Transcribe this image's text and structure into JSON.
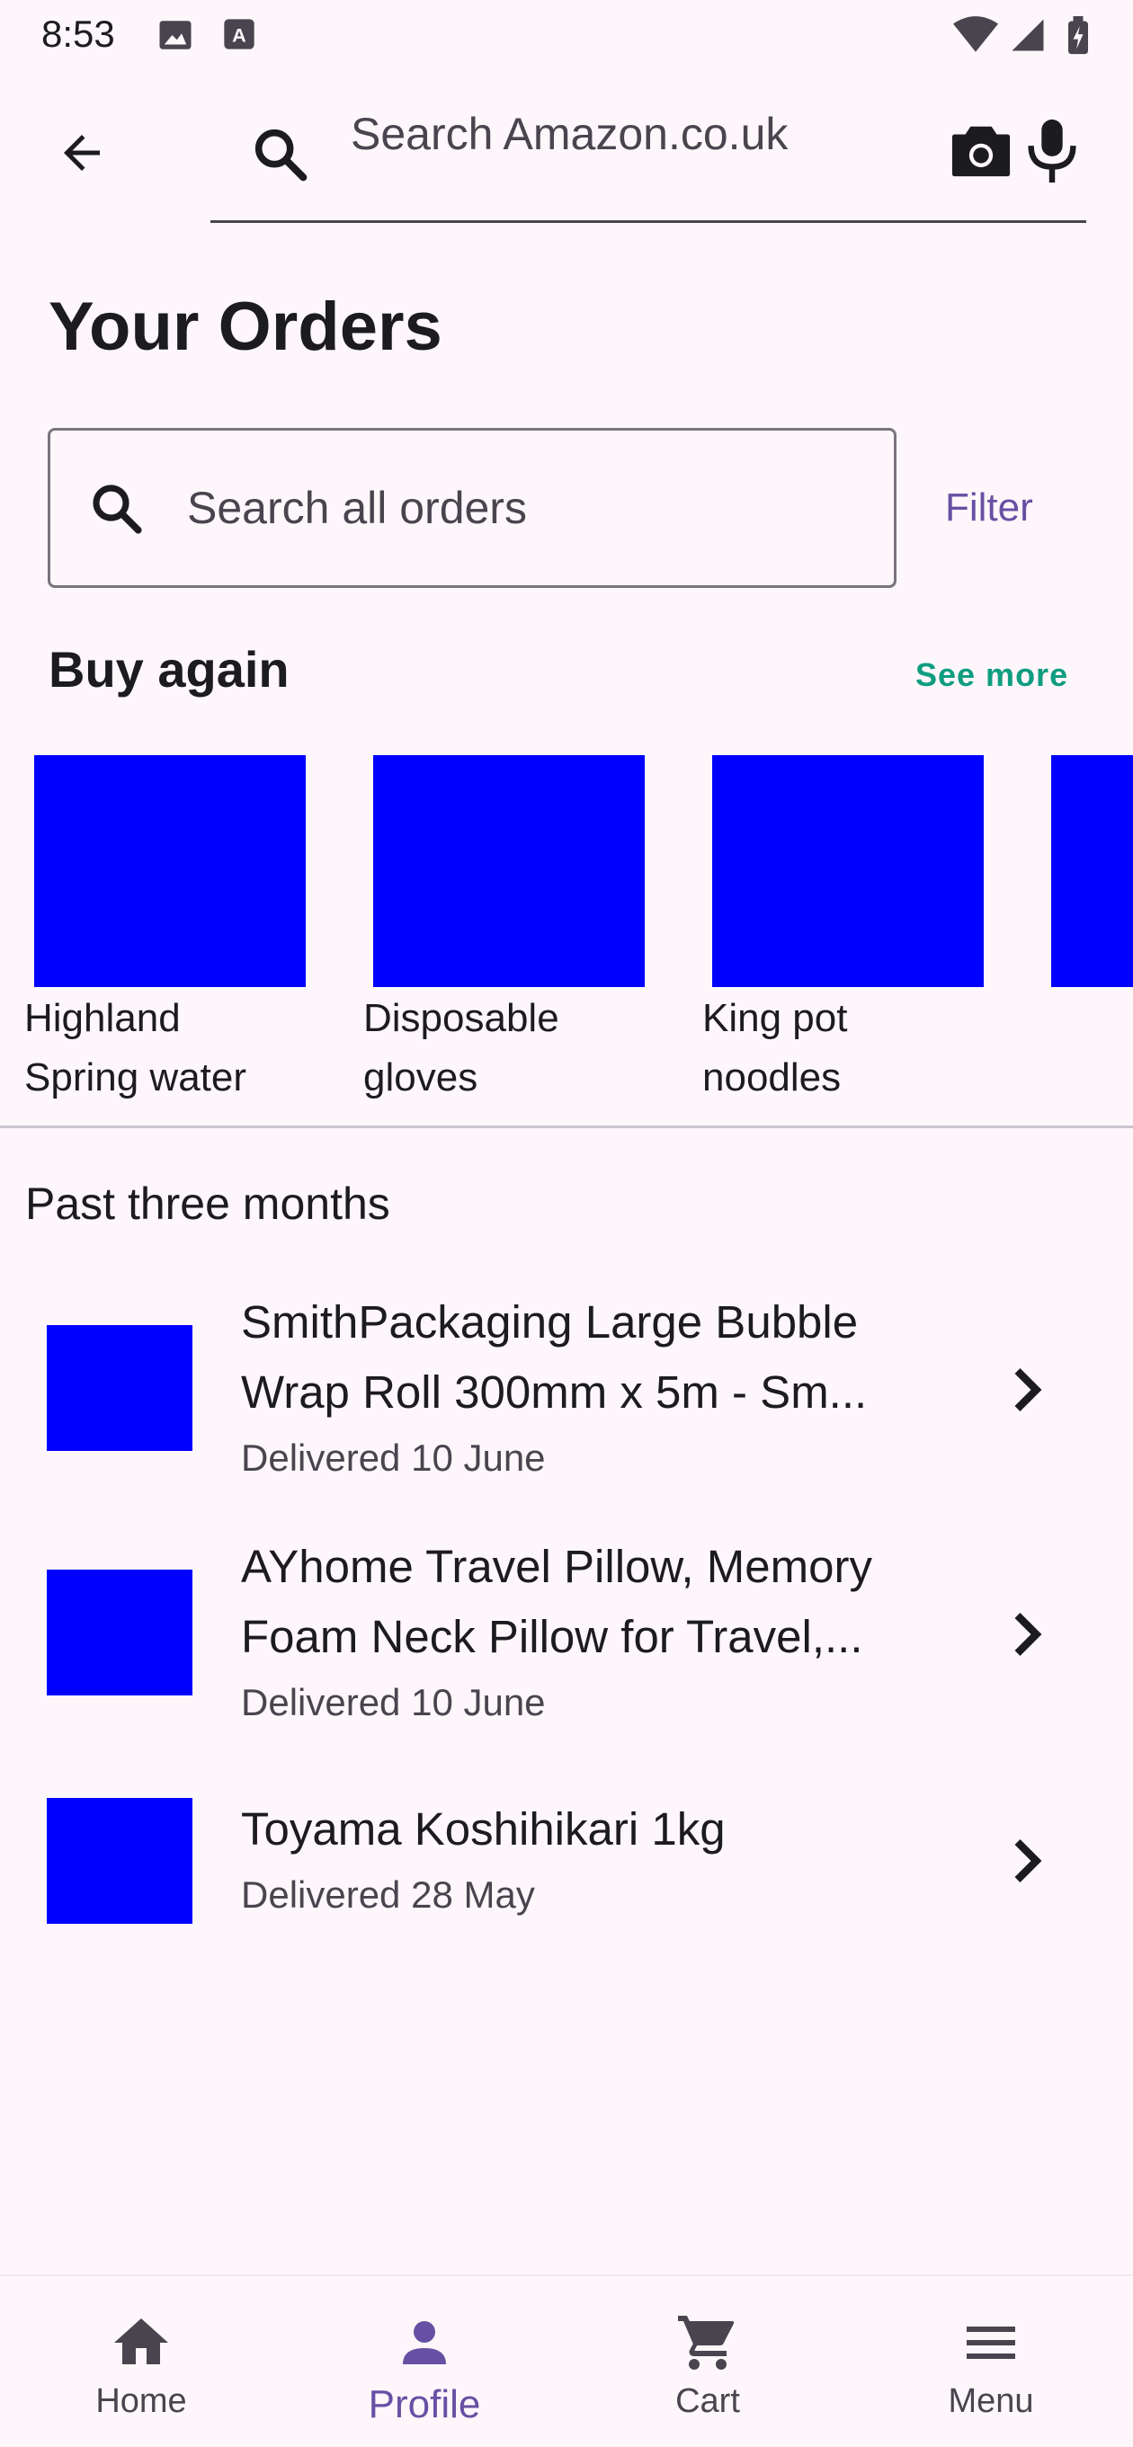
{
  "status_bar": {
    "time": "8:53"
  },
  "top_search": {
    "placeholder": "Search Amazon.co.uk"
  },
  "page": {
    "title": "Your Orders"
  },
  "orders_search": {
    "placeholder": "Search all orders",
    "filter_label": "Filter"
  },
  "buy_again": {
    "heading": "Buy again",
    "see_more": "See more",
    "items": [
      {
        "line1": "Highland",
        "line2": "Spring water"
      },
      {
        "line1": "Disposable",
        "line2": "gloves"
      },
      {
        "line1": "King pot",
        "line2": "noodles"
      }
    ]
  },
  "past": {
    "heading": "Past three months",
    "orders": [
      {
        "title1": "SmithPackaging Large Bubble",
        "title2": "Wrap Roll 300mm x 5m - Sm...",
        "status": "Delivered 10 June"
      },
      {
        "title1": "AYhome Travel Pillow, Memory",
        "title2": "Foam Neck Pillow for Travel,...",
        "status": "Delivered 10 June"
      },
      {
        "title1": "Toyama Koshihikari 1kg",
        "title2": "",
        "status": "Delivered 28 May"
      }
    ]
  },
  "nav": {
    "home": "Home",
    "profile": "Profile",
    "cart": "Cart",
    "menu": "Menu",
    "active": "profile",
    "accent_color": "#6750a4"
  }
}
